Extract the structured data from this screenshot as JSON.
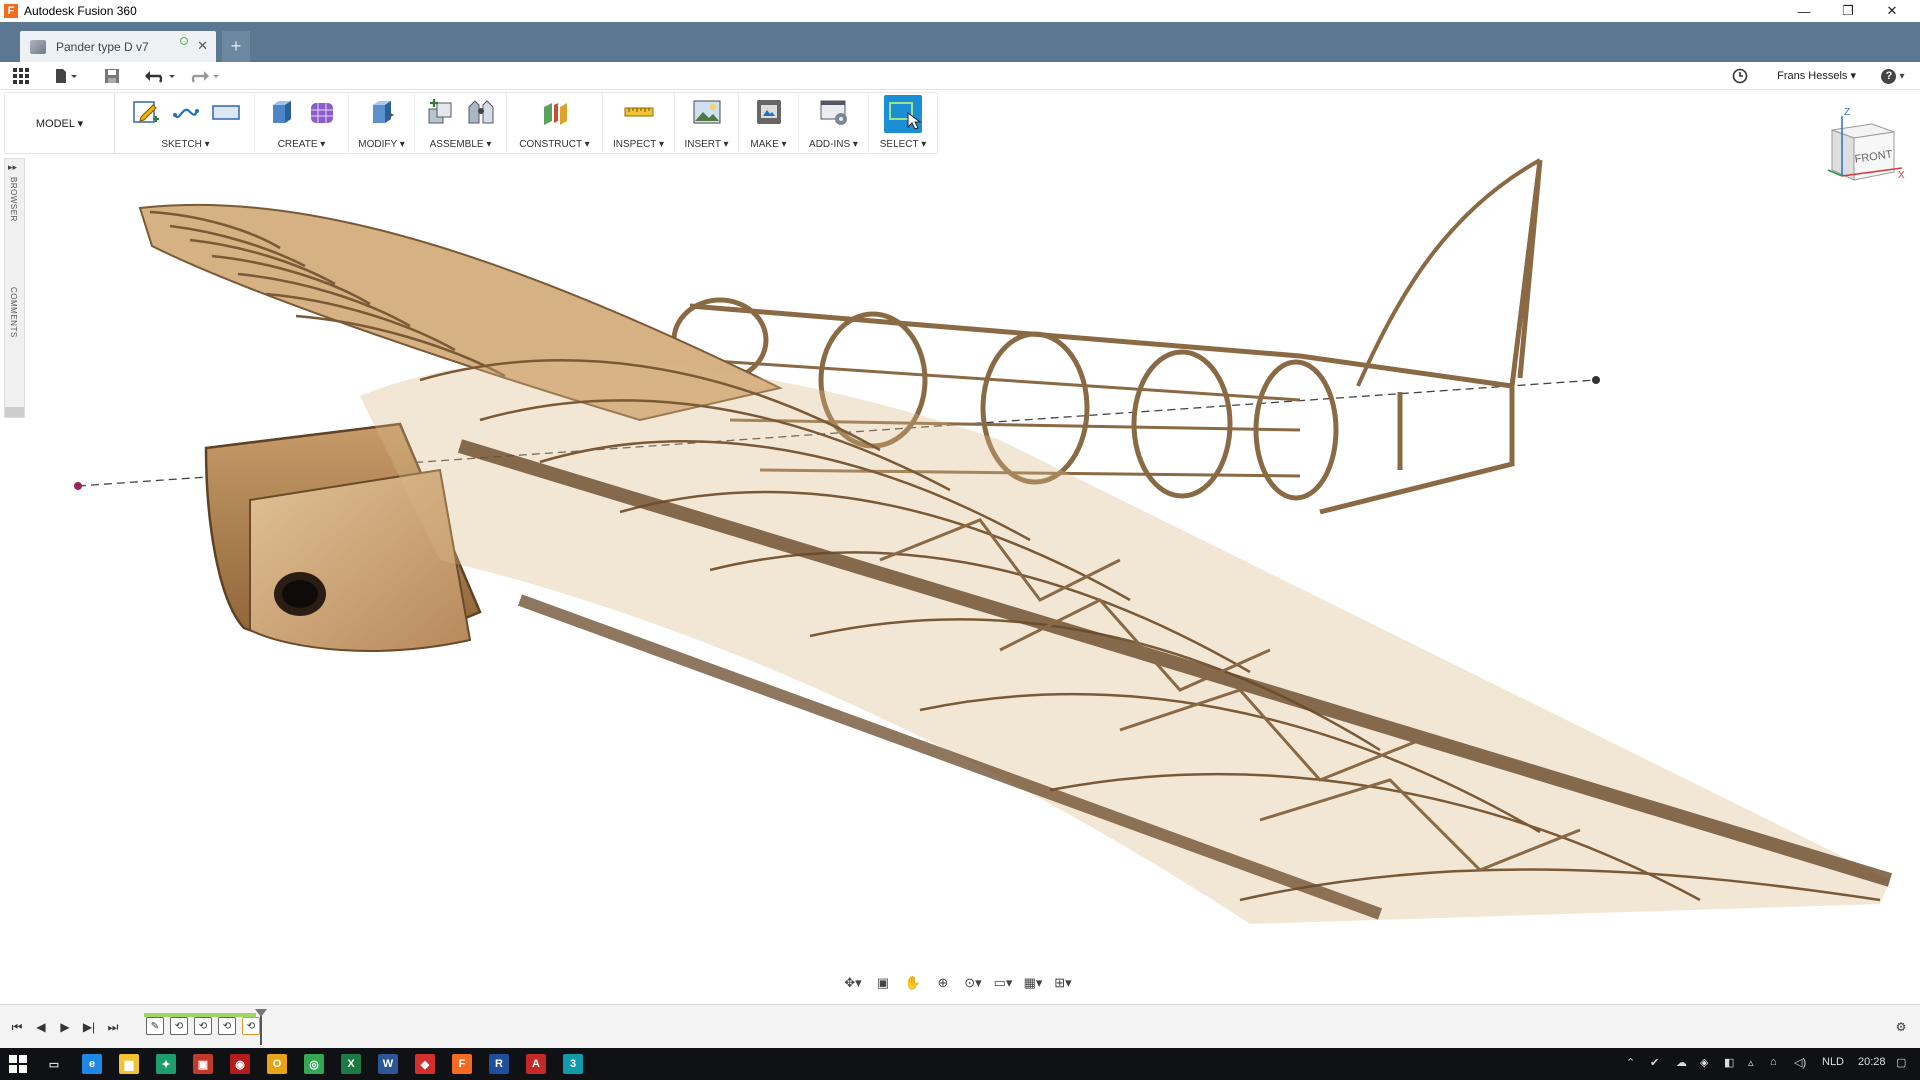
{
  "window": {
    "title": "Autodesk Fusion 360",
    "app_logo": "F",
    "controls": [
      "—",
      "❐",
      "✕"
    ]
  },
  "tabs": {
    "document": "Pander type D v7",
    "new_tab": "+"
  },
  "quick_access": {
    "user": "Frans Hessels",
    "user_caret": "▾",
    "help": "?",
    "help_caret": "▾"
  },
  "ribbon": {
    "workspace": "MODEL ▾",
    "groups": [
      {
        "label": "SKETCH ▾",
        "icons": [
          "sketch-icon",
          "spline-icon",
          "rectangle-icon"
        ]
      },
      {
        "label": "CREATE ▾",
        "icons": [
          "extrude-icon",
          "form-icon"
        ]
      },
      {
        "label": "MODIFY ▾",
        "icons": [
          "press-pull-icon"
        ]
      },
      {
        "label": "ASSEMBLE ▾",
        "icons": [
          "new-component-icon",
          "joint-icon"
        ]
      },
      {
        "label": "CONSTRUCT ▾",
        "icons": [
          "offset-plane-icon"
        ]
      },
      {
        "label": "INSPECT ▾",
        "icons": [
          "measure-icon"
        ]
      },
      {
        "label": "INSERT ▾",
        "icons": [
          "insert-image-icon"
        ]
      },
      {
        "label": "MAKE ▾",
        "icons": [
          "3d-print-icon"
        ]
      },
      {
        "label": "ADD-INS ▾",
        "icons": [
          "scripts-icon"
        ]
      },
      {
        "label": "SELECT ▾",
        "icons": [
          "select-icon"
        ]
      }
    ]
  },
  "browser_panel": {
    "browser": "BROWSER",
    "comments": "COMMENTS",
    "expand": "▸▸"
  },
  "viewcube": {
    "face": "FRONT",
    "x": "X",
    "z": "Z"
  },
  "timeline": {
    "play_controls": [
      "⏮",
      "◀",
      "▶",
      "▶|",
      "⏭"
    ],
    "features": [
      "✎",
      "⟲",
      "⟲",
      "⟲",
      "⟲"
    ]
  },
  "taskbar": {
    "apps": [
      {
        "name": "edge",
        "glyph": "e",
        "color": "#1e88e5"
      },
      {
        "name": "explorer",
        "glyph": "▆",
        "color": "#f2c230"
      },
      {
        "name": "app-green",
        "glyph": "✦",
        "color": "#1f9d6e"
      },
      {
        "name": "app-red",
        "glyph": "▣",
        "color": "#c0392b"
      },
      {
        "name": "app-circle",
        "glyph": "◉",
        "color": "#b71c1c"
      },
      {
        "name": "app-yellow",
        "glyph": "O",
        "color": "#e8a317"
      },
      {
        "name": "chrome",
        "glyph": "◎",
        "color": "#34a853"
      },
      {
        "name": "excel",
        "glyph": "X",
        "color": "#1d7a45"
      },
      {
        "name": "word",
        "glyph": "W",
        "color": "#2b5797"
      },
      {
        "name": "app-acrobat",
        "glyph": "◆",
        "color": "#d32f2f"
      },
      {
        "name": "fusion",
        "glyph": "F",
        "color": "#f26b21"
      },
      {
        "name": "revit",
        "glyph": "R",
        "color": "#1f4e9b"
      },
      {
        "name": "autocad",
        "glyph": "A",
        "color": "#c62828"
      },
      {
        "name": "app-3",
        "glyph": "3",
        "color": "#0f9bab"
      }
    ],
    "language": "NLD",
    "clock": "20:28"
  },
  "colors": {
    "tab_strip": "#5b7791",
    "wood": "#c9a273",
    "wood_dark": "#7a5a36",
    "select_accent": "#1a8fd6"
  }
}
